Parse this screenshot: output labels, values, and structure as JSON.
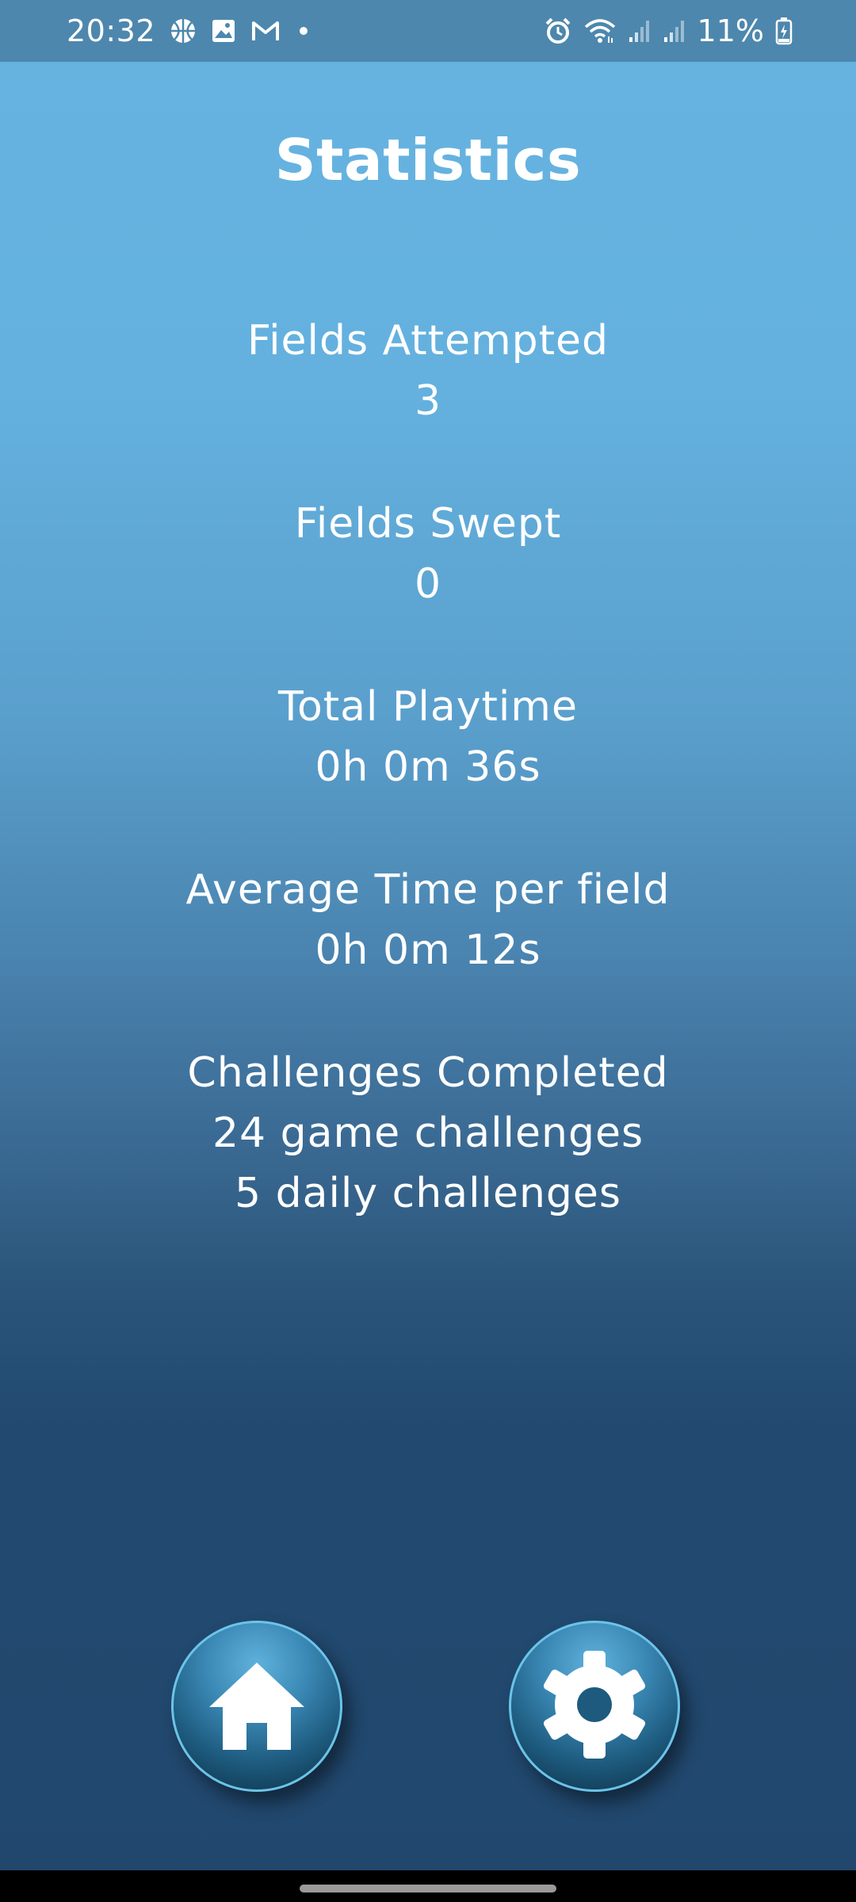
{
  "status_bar": {
    "time": "20:32",
    "battery": "11%",
    "left_icons": [
      "basketball-icon",
      "image-icon",
      "gmail-icon",
      "dot-icon"
    ],
    "right_icons": [
      "alarm-icon",
      "wifi-icon",
      "signal-icon",
      "signal-icon",
      "battery-charging-icon"
    ]
  },
  "page": {
    "title": "Statistics"
  },
  "stats": {
    "fields_attempted": {
      "label": "Fields Attempted",
      "value": "3"
    },
    "fields_swept": {
      "label": "Fields Swept",
      "value": "0"
    },
    "total_playtime": {
      "label": "Total Playtime",
      "value": "0h 0m 36s"
    },
    "average_time": {
      "label": "Average Time per field",
      "value": "0h 0m 12s"
    },
    "challenges": {
      "label": "Challenges Completed",
      "game": "24 game challenges",
      "daily": "5 daily challenges"
    }
  },
  "nav": {
    "home_icon": "home-icon",
    "settings_icon": "gear-icon"
  },
  "colors": {
    "status_bar": "#4d87ad",
    "gradient_top": "#66b3e0",
    "gradient_bottom": "#21476d",
    "button_border": "#6cc3e8"
  }
}
